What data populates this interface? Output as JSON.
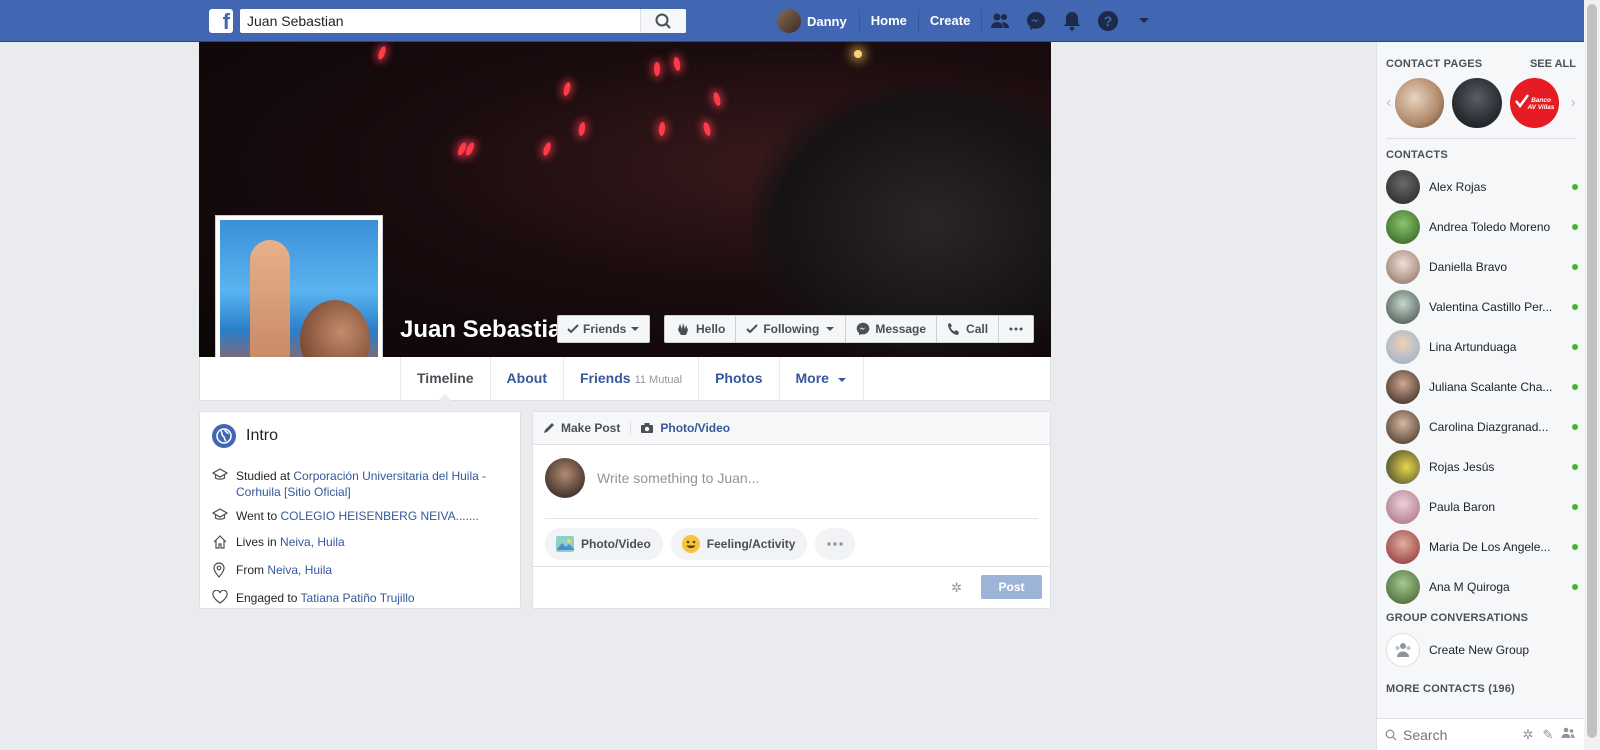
{
  "topbar": {
    "search_value": "Juan Sebastian",
    "user_name": "Danny",
    "home_label": "Home",
    "create_label": "Create"
  },
  "profile": {
    "name": "Juan Sebastian",
    "friends_button": "Friends",
    "hello_button": "Hello",
    "following_button": "Following",
    "message_button": "Message",
    "call_button": "Call"
  },
  "tabs": {
    "timeline": "Timeline",
    "about": "About",
    "friends": "Friends",
    "mutual": "11 Mutual",
    "photos": "Photos",
    "more": "More"
  },
  "intro": {
    "title": "Intro",
    "items": [
      {
        "prefix": "Studied at ",
        "link": "Corporación Universitaria del Huila - Corhuila [Sitio Oficial]"
      },
      {
        "prefix": "Went to ",
        "link": "COLEGIO HEISENBERG NEIVA......."
      },
      {
        "prefix": "Lives in ",
        "link": "Neiva, Huila"
      },
      {
        "prefix": "From ",
        "link": "Neiva, Huila"
      },
      {
        "prefix": "Engaged to ",
        "link": "Tatiana Patiño Trujillo"
      }
    ]
  },
  "composer": {
    "make_post": "Make Post",
    "photo_video_tab": "Photo/Video",
    "placeholder": "Write something to Juan...",
    "chip_photo": "Photo/Video",
    "chip_feeling": "Feeling/Activity",
    "post_button": "Post"
  },
  "sidebar": {
    "contact_pages_title": "CONTACT PAGES",
    "see_all": "SEE ALL",
    "contacts_title": "CONTACTS",
    "contacts": [
      {
        "name": "Alex Rojas"
      },
      {
        "name": "Andrea Toledo Moreno"
      },
      {
        "name": "Daniella Bravo"
      },
      {
        "name": "Valentina Castillo Per..."
      },
      {
        "name": "Lina Artunduaga"
      },
      {
        "name": "Juliana Scalante Cha..."
      },
      {
        "name": "Carolina Diazgranad..."
      },
      {
        "name": "Rojas Jesús"
      },
      {
        "name": "Paula Baron"
      },
      {
        "name": "Maria De Los Angele..."
      },
      {
        "name": "Ana M Quiroga"
      }
    ],
    "group_conversations_title": "GROUP CONVERSATIONS",
    "create_group": "Create New Group",
    "more_contacts": "MORE CONTACTS (196)",
    "search_placeholder": "Search"
  },
  "page_logos": {
    "bank_logo_text": "Banco AV Villas"
  },
  "colors": {
    "brand_blue": "#4267b2",
    "link_blue": "#365899",
    "online_green": "#42b72a",
    "post_button_disabled": "#9cb4d8"
  }
}
